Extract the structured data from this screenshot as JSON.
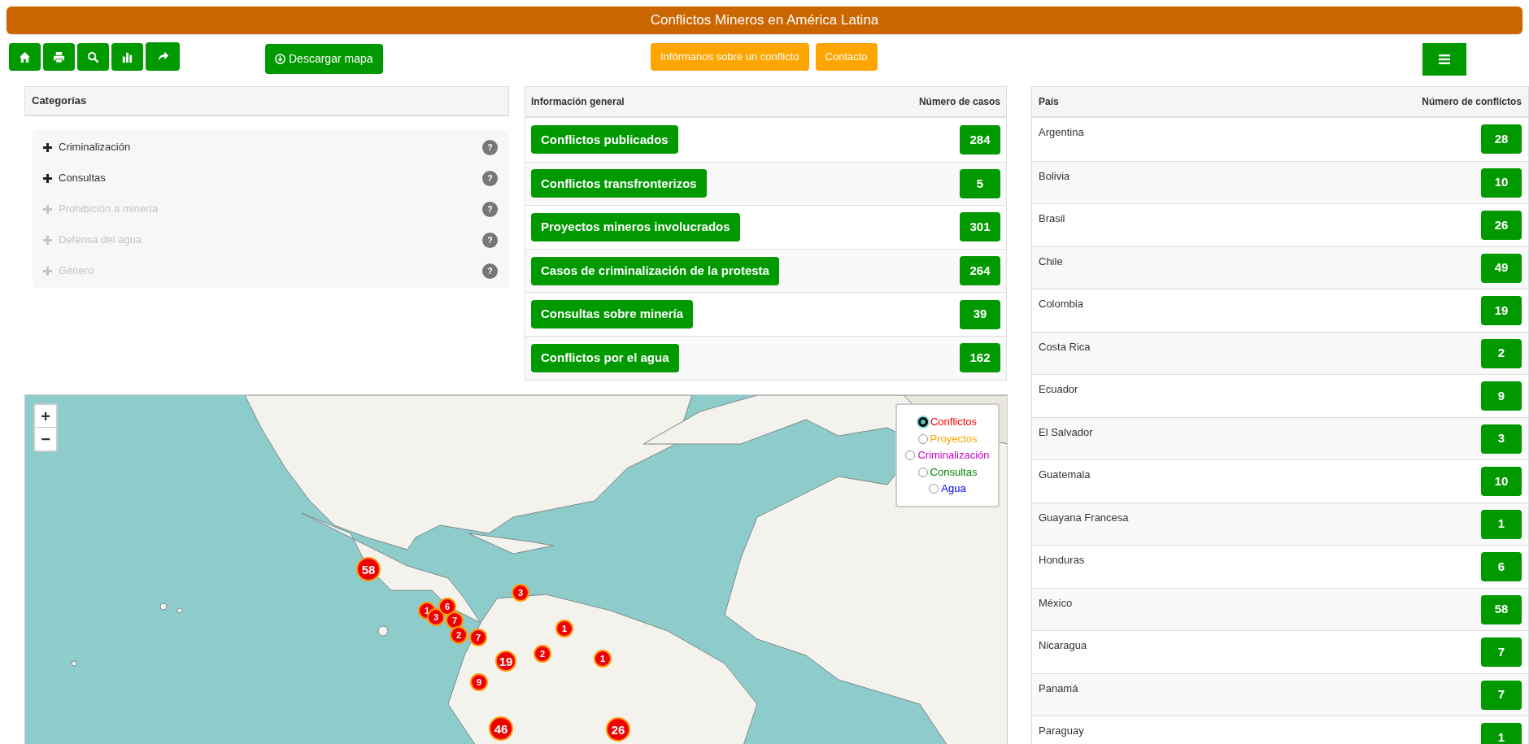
{
  "header": {
    "title": "Conflictos Mineros en América Latina"
  },
  "toolbar": {
    "icon_buttons": [
      {
        "kind": "home"
      },
      {
        "kind": "print"
      },
      {
        "kind": "search"
      },
      {
        "kind": "chart"
      },
      {
        "kind": "share"
      }
    ],
    "download": "Descargar mapa",
    "links": [
      "Infórmanos sobre un conflicto",
      "Contacto"
    ]
  },
  "categories": {
    "title": "Categorías",
    "items": [
      {
        "label": "Criminalización",
        "disabled": false,
        "help": "?"
      },
      {
        "label": "Consultas",
        "disabled": false,
        "help": "?"
      },
      {
        "label": "Prohibición a minería",
        "disabled": true,
        "help": "?"
      },
      {
        "label": "Defensa del agua",
        "disabled": true,
        "help": "?"
      },
      {
        "label": "Género",
        "disabled": true,
        "help": "?"
      }
    ]
  },
  "general_info": {
    "columns": [
      "Información general",
      "Número de casos"
    ],
    "rows": [
      {
        "label": "Conflictos publicados",
        "count": "284"
      },
      {
        "label": "Conflictos transfronterizos",
        "count": "5"
      },
      {
        "label": "Proyectos mineros involucrados",
        "count": "301"
      },
      {
        "label": "Casos de criminalización de la protesta",
        "count": "264"
      },
      {
        "label": "Consultas sobre minería",
        "count": "39"
      },
      {
        "label": "Conflictos por el agua",
        "count": "162"
      }
    ]
  },
  "countries": {
    "columns": [
      "País",
      "Número de conflictos"
    ],
    "rows": [
      {
        "name": "Argentina",
        "count": "28"
      },
      {
        "name": "Bolivia",
        "count": "10"
      },
      {
        "name": "Brasil",
        "count": "26"
      },
      {
        "name": "Chile",
        "count": "49"
      },
      {
        "name": "Colombia",
        "count": "19"
      },
      {
        "name": "Costa Rica",
        "count": "2"
      },
      {
        "name": "Ecuador",
        "count": "9"
      },
      {
        "name": "El Salvador",
        "count": "3"
      },
      {
        "name": "Guatemala",
        "count": "10"
      },
      {
        "name": "Guayana Francesa",
        "count": "1"
      },
      {
        "name": "Honduras",
        "count": "6"
      },
      {
        "name": "México",
        "count": "58"
      },
      {
        "name": "Nicaragua",
        "count": "7"
      },
      {
        "name": "Panamá",
        "count": "7"
      },
      {
        "name": "Paraguay",
        "count": "1"
      }
    ]
  },
  "map": {
    "zoom_controls": [
      "+",
      "−"
    ],
    "layers": [
      {
        "label": "Conflictos",
        "color": "#ff0000",
        "selected": true
      },
      {
        "label": "Proyectos",
        "color": "#ffa500",
        "selected": false
      },
      {
        "label": "Criminalización",
        "color": "#cc00cc",
        "selected": false
      },
      {
        "label": "Consultas",
        "color": "#008000",
        "selected": false
      },
      {
        "label": "Agua",
        "color": "#0000ff",
        "selected": false
      }
    ],
    "markers": [
      "58",
      "1",
      "3",
      "6",
      "7",
      "2",
      "7",
      "3",
      "1",
      "2",
      "19",
      "1",
      "9",
      "46",
      "26"
    ]
  }
}
